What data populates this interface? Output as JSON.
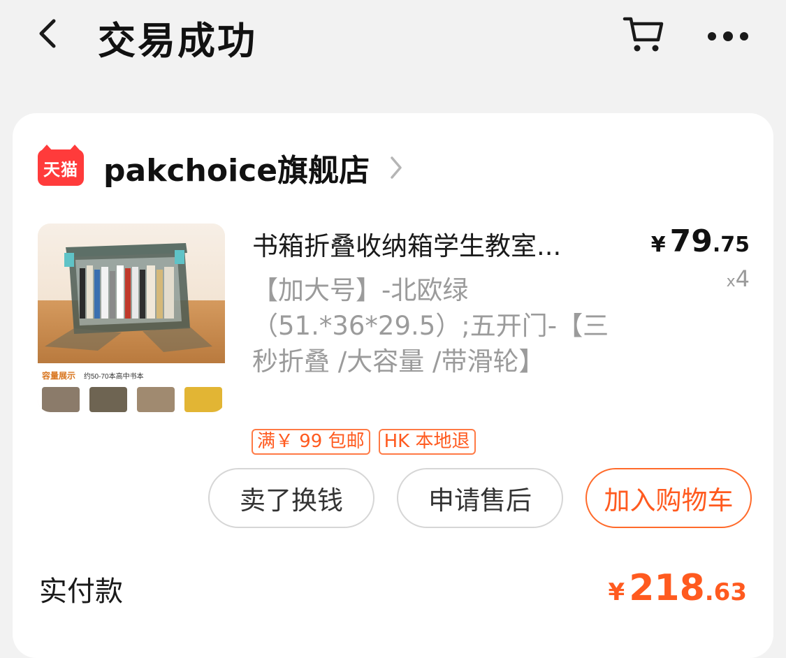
{
  "header": {
    "title": "交易成功",
    "back_icon": "chevron-left-icon",
    "cart_icon": "cart-icon",
    "more_icon": "more-dots-icon"
  },
  "store": {
    "badge": "天猫",
    "name": "pakchoice旗舰店"
  },
  "product": {
    "title": "书箱折叠收纳箱学生教室...",
    "price_currency": "¥",
    "price_int": "79",
    "price_dec": ".75",
    "quantity_prefix": "x",
    "quantity": "4",
    "sku": "【加大号】-北欧绿（51.*36*29.5）;五开门-【三秒折叠 /大容量 /带滑轮】",
    "image_caption": "容量展示",
    "image_caption_sub": "约50-70本高中书本",
    "tags": [
      "满￥ 99 包邮",
      "HK 本地退"
    ]
  },
  "actions": {
    "sell": "卖了换钱",
    "after_sale": "申请售后",
    "add_cart": "加入购物车"
  },
  "total": {
    "label": "实付款",
    "currency": "¥",
    "int": "218",
    "dec": ".63"
  },
  "colors": {
    "accent": "#ff5a1f",
    "tmall_red": "#ff3b3b",
    "background": "#f2f2f2"
  }
}
